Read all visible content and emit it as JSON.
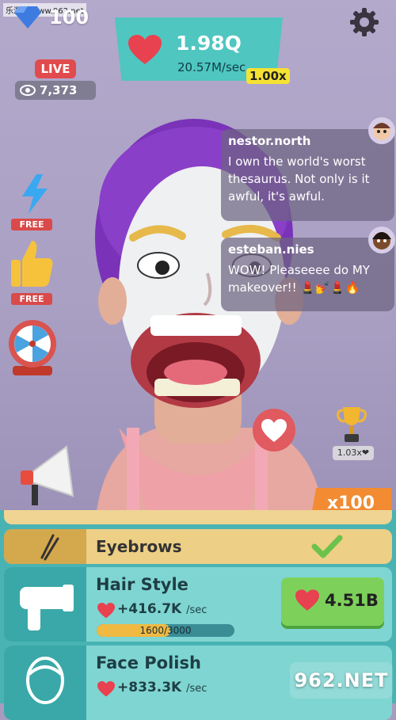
{
  "watermark": "乐游网 www.962.net",
  "hud": {
    "gems": "100",
    "score": "1.98Q",
    "rate": "20.57M/sec",
    "multiplier": "1.00x",
    "live": "LIVE",
    "viewers": "7,373"
  },
  "side_buttons": {
    "boost_free": "FREE",
    "like_free": "FREE"
  },
  "chat": [
    {
      "user": "nestor.north",
      "message": "I own the world's worst thesaurus. Not only is it awful, it's awful."
    },
    {
      "user": "esteban.nies",
      "message": "WOW! Pleaseeee do MY makeover!! 💄💅💄🔥"
    }
  ],
  "trophy_label": "1.03x❤",
  "x100_label": "x100",
  "upgrades": {
    "eyebrows": {
      "title": "Eyebrows"
    },
    "hair_style": {
      "title": "Hair Style",
      "rate": "+416.7K",
      "rate_unit": "/sec",
      "progress_text": "1600/3000",
      "progress": 0.533,
      "price": "4.51B"
    },
    "face_polish": {
      "title": "Face Polish",
      "rate": "+833.3K",
      "rate_unit": "/sec"
    }
  },
  "watermark2": "962.NET",
  "colors": {
    "accent": "#4fc6c0",
    "heart": "#e8414f",
    "buy": "#7dd15b",
    "panel": "#49b3b3"
  }
}
